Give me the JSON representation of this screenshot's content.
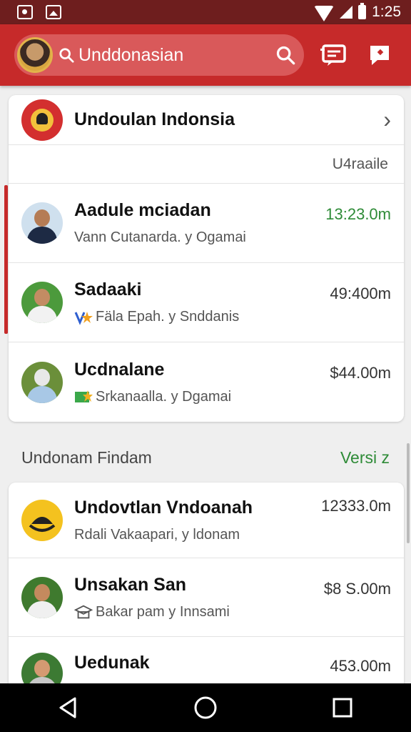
{
  "status_bar": {
    "time": "1:25"
  },
  "app_bar": {
    "search_text": "Unddonasian"
  },
  "card_top": {
    "header_title": "Undoulan Indonsia",
    "subheader": "U4raaile",
    "rows": [
      {
        "title": "Aadule mciadan",
        "subtitle": "Vann Cutanarda. y Ogamai",
        "value": "13:23.0m",
        "value_green": true
      },
      {
        "title": "Sadaaki",
        "subtitle": "Fäla Epah. y Snddanis",
        "value": "49:400m",
        "value_green": false
      },
      {
        "title": "Ucdnalane",
        "subtitle": "Srkanaalla. y Dgamai",
        "value": "$44.00m",
        "value_green": false
      }
    ]
  },
  "section": {
    "title": "Undonam Findam",
    "link": "Versi z"
  },
  "card_bottom": {
    "rows": [
      {
        "title": "Undovtlan Vndoanah",
        "subtitle": "Rdali Vakaapari, y ldonam",
        "value": "12333.0m"
      },
      {
        "title": "Unsakan San",
        "subtitle": "Bakar pam y Innsami",
        "value": "$8 S.00m"
      },
      {
        "title": "Uedunak",
        "subtitle": "",
        "value": "453.00m"
      }
    ]
  },
  "colors": {
    "brand_red": "#c62a2a",
    "status_bar": "#6e1e1e",
    "accent_green": "#2e8b37"
  },
  "icons": [
    "camera-icon",
    "image-icon",
    "wifi-icon",
    "signal-icon",
    "battery-icon",
    "search-icon",
    "message-icon",
    "report-icon",
    "chevron-right-icon",
    "back-icon",
    "home-icon",
    "recents-icon"
  ]
}
